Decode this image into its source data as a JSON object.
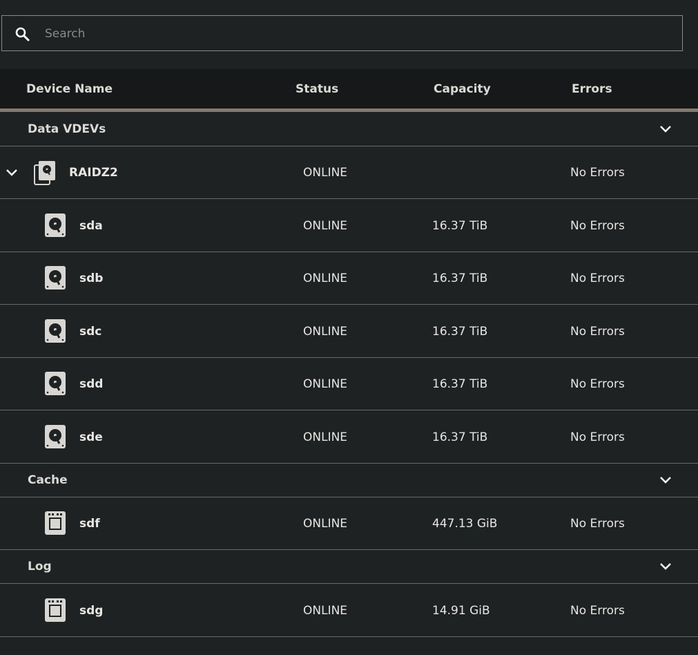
{
  "search": {
    "placeholder": "Search",
    "value": ""
  },
  "columns": {
    "name": "Device Name",
    "status": "Status",
    "capacity": "Capacity",
    "errors": "Errors"
  },
  "sections": {
    "data": {
      "title": "Data VDEVs"
    },
    "cache": {
      "title": "Cache"
    },
    "log": {
      "title": "Log"
    }
  },
  "vdev": {
    "name": "RAIDZ2",
    "status": "ONLINE",
    "capacity": "",
    "errors": "No Errors",
    "icon": "raidz-icon"
  },
  "disks": [
    {
      "name": "sda",
      "status": "ONLINE",
      "capacity": "16.37 TiB",
      "errors": "No Errors",
      "icon": "hdd-icon"
    },
    {
      "name": "sdb",
      "status": "ONLINE",
      "capacity": "16.37 TiB",
      "errors": "No Errors",
      "icon": "hdd-icon"
    },
    {
      "name": "sdc",
      "status": "ONLINE",
      "capacity": "16.37 TiB",
      "errors": "No Errors",
      "icon": "hdd-icon"
    },
    {
      "name": "sdd",
      "status": "ONLINE",
      "capacity": "16.37 TiB",
      "errors": "No Errors",
      "icon": "hdd-icon"
    },
    {
      "name": "sde",
      "status": "ONLINE",
      "capacity": "16.37 TiB",
      "errors": "No Errors",
      "icon": "hdd-icon"
    }
  ],
  "cache": [
    {
      "name": "sdf",
      "status": "ONLINE",
      "capacity": "447.13 GiB",
      "errors": "No Errors",
      "icon": "ssd-icon"
    }
  ],
  "log": [
    {
      "name": "sdg",
      "status": "ONLINE",
      "capacity": "14.91 GiB",
      "errors": "No Errors",
      "icon": "ssd-icon"
    }
  ],
  "colors": {
    "background": "#1f2223",
    "header": "#161819",
    "accent_bar": "#827a70",
    "divider": "#6a6a66"
  }
}
